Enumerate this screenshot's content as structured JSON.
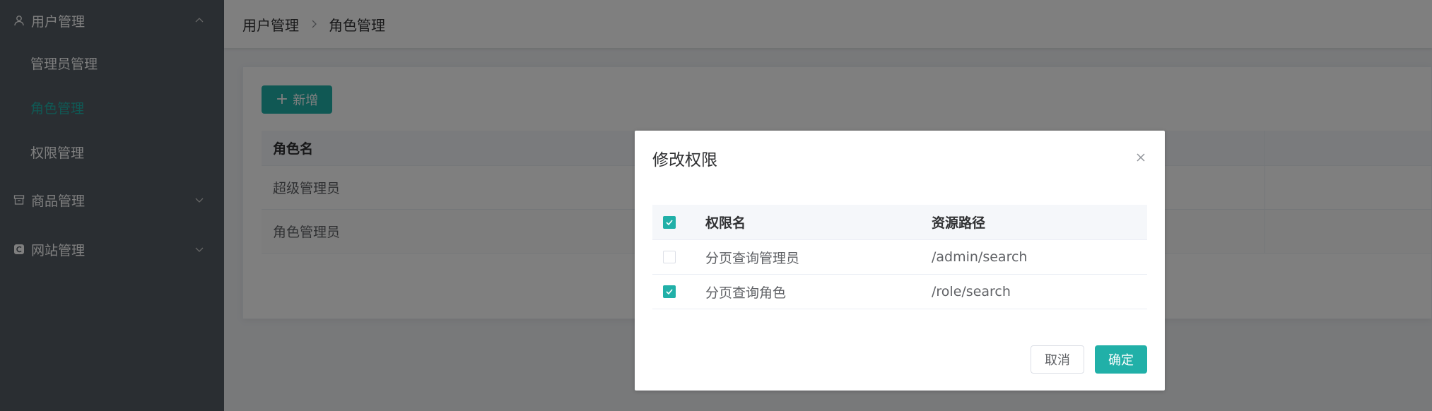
{
  "sidebar": {
    "groups": [
      {
        "label": "用户管理",
        "icon": "user-icon",
        "expanded": true,
        "items": [
          {
            "label": "管理员管理"
          },
          {
            "label": "角色管理",
            "active": true
          },
          {
            "label": "权限管理"
          }
        ]
      },
      {
        "label": "商品管理",
        "icon": "box-icon",
        "expanded": false
      },
      {
        "label": "网站管理",
        "icon": "website-icon",
        "expanded": false
      }
    ]
  },
  "breadcrumb": {
    "parent": "用户管理",
    "current": "角色管理"
  },
  "toolbar": {
    "add_label": "新增"
  },
  "role_table": {
    "header": "角色名",
    "rows": [
      {
        "name": "超级管理员"
      },
      {
        "name": "角色管理员"
      }
    ]
  },
  "dialog": {
    "title": "修改权限",
    "header": {
      "name": "权限名",
      "path": "资源路径",
      "all_checked": true
    },
    "rows": [
      {
        "name": "分页查询管理员",
        "path": "/admin/search",
        "checked": false
      },
      {
        "name": "分页查询角色",
        "path": "/role/search",
        "checked": true
      }
    ],
    "cancel_label": "取消",
    "ok_label": "确定"
  },
  "colors": {
    "primary": "#21b0a8",
    "sidebar_bg": "#545c64",
    "mask": "rgba(0,0,0,0.5)"
  }
}
